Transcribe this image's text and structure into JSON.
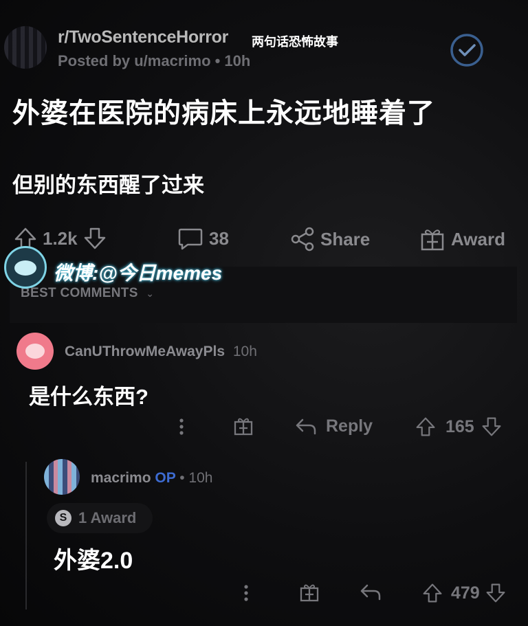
{
  "header": {
    "subreddit": "r/TwoSentenceHorror",
    "subreddit_cn": "两句话恐怖故事",
    "posted_by": "Posted by u/macrimo • 10h"
  },
  "post": {
    "title": "外婆在医院的病床上永远地睡着了",
    "body": "但别的东西醒了过来",
    "upvotes": "1.2k",
    "comments": "38",
    "share_label": "Share",
    "award_label": "Award"
  },
  "watermark": {
    "text": "微博:@今日memes"
  },
  "comments_section": {
    "sort_label": "BEST COMMENTS"
  },
  "comments": [
    {
      "user": "CanUThrowMeAwayPls",
      "time": "10h",
      "text": "是什么东西?",
      "reply_label": "Reply",
      "votes": "165"
    },
    {
      "user": "macrimo",
      "op_badge": "OP",
      "time": "• 10h",
      "award": "1 Award",
      "award_icon": "S",
      "text": "外婆2.0",
      "votes": "479"
    }
  ],
  "colors": {
    "background": "#0b0b0c",
    "text_primary": "#ffffff",
    "text_muted": "#8a8a8e",
    "op_blue": "#3d6bd1",
    "avatar_pink": "#f07a8b"
  }
}
